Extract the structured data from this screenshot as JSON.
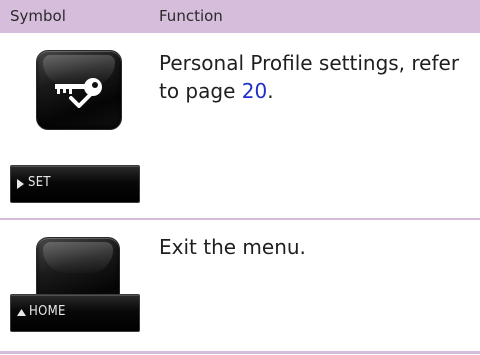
{
  "header": {
    "symbol_label": "Symbol",
    "function_label": "Function"
  },
  "rows": [
    {
      "key_icon": "key-check-icon",
      "soft_key_label": "SET",
      "soft_key_indicator": "right-triangle-icon",
      "description_text": "Personal Profile settings, refer to page ",
      "page_link": "20",
      "description_end": "."
    },
    {
      "key_icon": "blank",
      "soft_key_label": "HOME",
      "soft_key_indicator": "up-triangle-icon",
      "description_text": "Exit the menu."
    }
  ],
  "colors": {
    "header_bg": "#d6bddc",
    "divider": "#d6bddc",
    "link": "#2030c8"
  }
}
